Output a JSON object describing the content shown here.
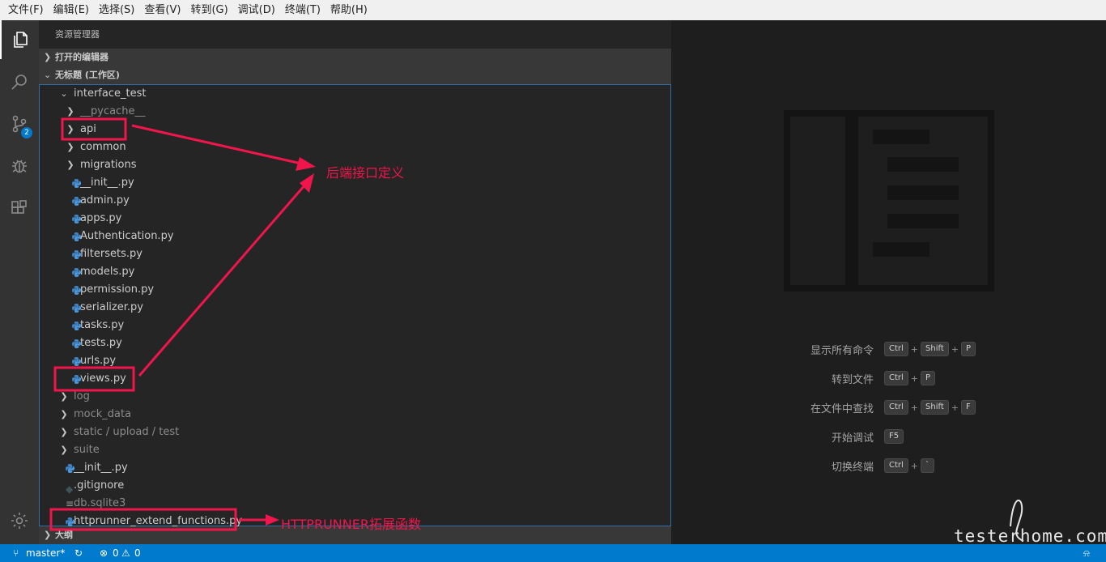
{
  "menu": [
    "文件(F)",
    "编辑(E)",
    "选择(S)",
    "查看(V)",
    "转到(G)",
    "调试(D)",
    "终端(T)",
    "帮助(H)"
  ],
  "activity": {
    "source_control_badge": "2"
  },
  "sidebar": {
    "title": "资源管理器",
    "open_editors": "打开的编辑器",
    "workspace": "无标题 (工作区)",
    "outline": "大纲",
    "tree": [
      {
        "label": "interface_test",
        "type": "folder",
        "expanded": true
      },
      {
        "label": "__pycache__",
        "type": "folder",
        "dim": true
      },
      {
        "label": "api",
        "type": "folder"
      },
      {
        "label": "common",
        "type": "folder"
      },
      {
        "label": "migrations",
        "type": "folder"
      },
      {
        "label": "__init__.py",
        "type": "python"
      },
      {
        "label": "admin.py",
        "type": "python"
      },
      {
        "label": "apps.py",
        "type": "python"
      },
      {
        "label": "Authentication.py",
        "type": "python"
      },
      {
        "label": "filtersets.py",
        "type": "python"
      },
      {
        "label": "models.py",
        "type": "python"
      },
      {
        "label": "permission.py",
        "type": "python"
      },
      {
        "label": "serializer.py",
        "type": "python"
      },
      {
        "label": "tasks.py",
        "type": "python"
      },
      {
        "label": "tests.py",
        "type": "python"
      },
      {
        "label": "urls.py",
        "type": "python"
      },
      {
        "label": "views.py",
        "type": "python"
      },
      {
        "label": "log",
        "type": "folder",
        "dim": true
      },
      {
        "label": "mock_data",
        "type": "folder",
        "dim": true
      },
      {
        "label": "static / upload / test",
        "type": "folder",
        "dim": true
      },
      {
        "label": "suite",
        "type": "folder",
        "dim": true
      },
      {
        "label": "__init__.py",
        "type": "python"
      },
      {
        "label": ".gitignore",
        "type": "git"
      },
      {
        "label": "db.sqlite3",
        "type": "db",
        "dim": true
      },
      {
        "label": "httprunner_extend_functions.py",
        "type": "python"
      }
    ]
  },
  "editor": {
    "shortcuts": [
      {
        "label": "显示所有命令",
        "keys": [
          "Ctrl",
          "Shift",
          "P"
        ]
      },
      {
        "label": "转到文件",
        "keys": [
          "Ctrl",
          "P"
        ]
      },
      {
        "label": "在文件中查找",
        "keys": [
          "Ctrl",
          "Shift",
          "F"
        ]
      },
      {
        "label": "开始调试",
        "keys": [
          "F5"
        ]
      },
      {
        "label": "切换终端",
        "keys": [
          "Ctrl",
          "`"
        ]
      }
    ]
  },
  "statusbar": {
    "branch": "master*",
    "errors": "0",
    "warnings": "0"
  },
  "annotations": {
    "backend_api": "后端接口定义",
    "httprunner": "HTTPRUNNER拓展函数",
    "watermark": "testerhome.com",
    "color": "#f0164b"
  }
}
